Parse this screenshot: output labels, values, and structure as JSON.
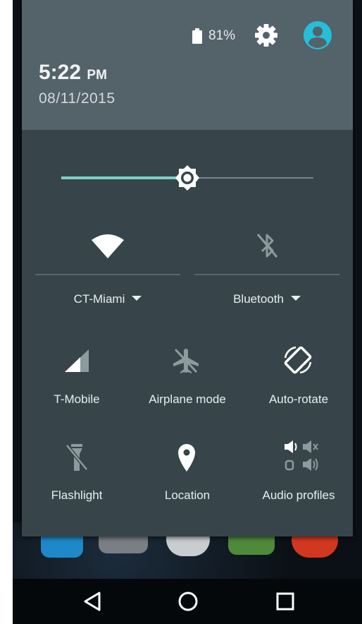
{
  "status": {
    "battery_percent": "81%",
    "battery_icon": "battery-icon",
    "settings_icon": "gear-icon",
    "user_icon": "account-icon"
  },
  "header": {
    "time": "5:22",
    "ampm": "PM",
    "date": "08/11/2015"
  },
  "brightness": {
    "level": 0.5,
    "icon": "brightness-icon"
  },
  "wifi": {
    "network": "CT-Miami",
    "icon": "wifi-icon"
  },
  "bluetooth": {
    "label": "Bluetooth",
    "icon": "bluetooth-off-icon"
  },
  "tiles": {
    "mobile": "T-Mobile",
    "airplane": "Airplane mode",
    "rotate": "Auto-rotate",
    "flashlight": "Flashlight",
    "location": "Location",
    "audio": "Audio profiles"
  },
  "colors": {
    "header_bg": "#54626a",
    "panel_bg": "#37454a",
    "accent": "#7fcfc6",
    "avatar": "#26bfd9"
  }
}
